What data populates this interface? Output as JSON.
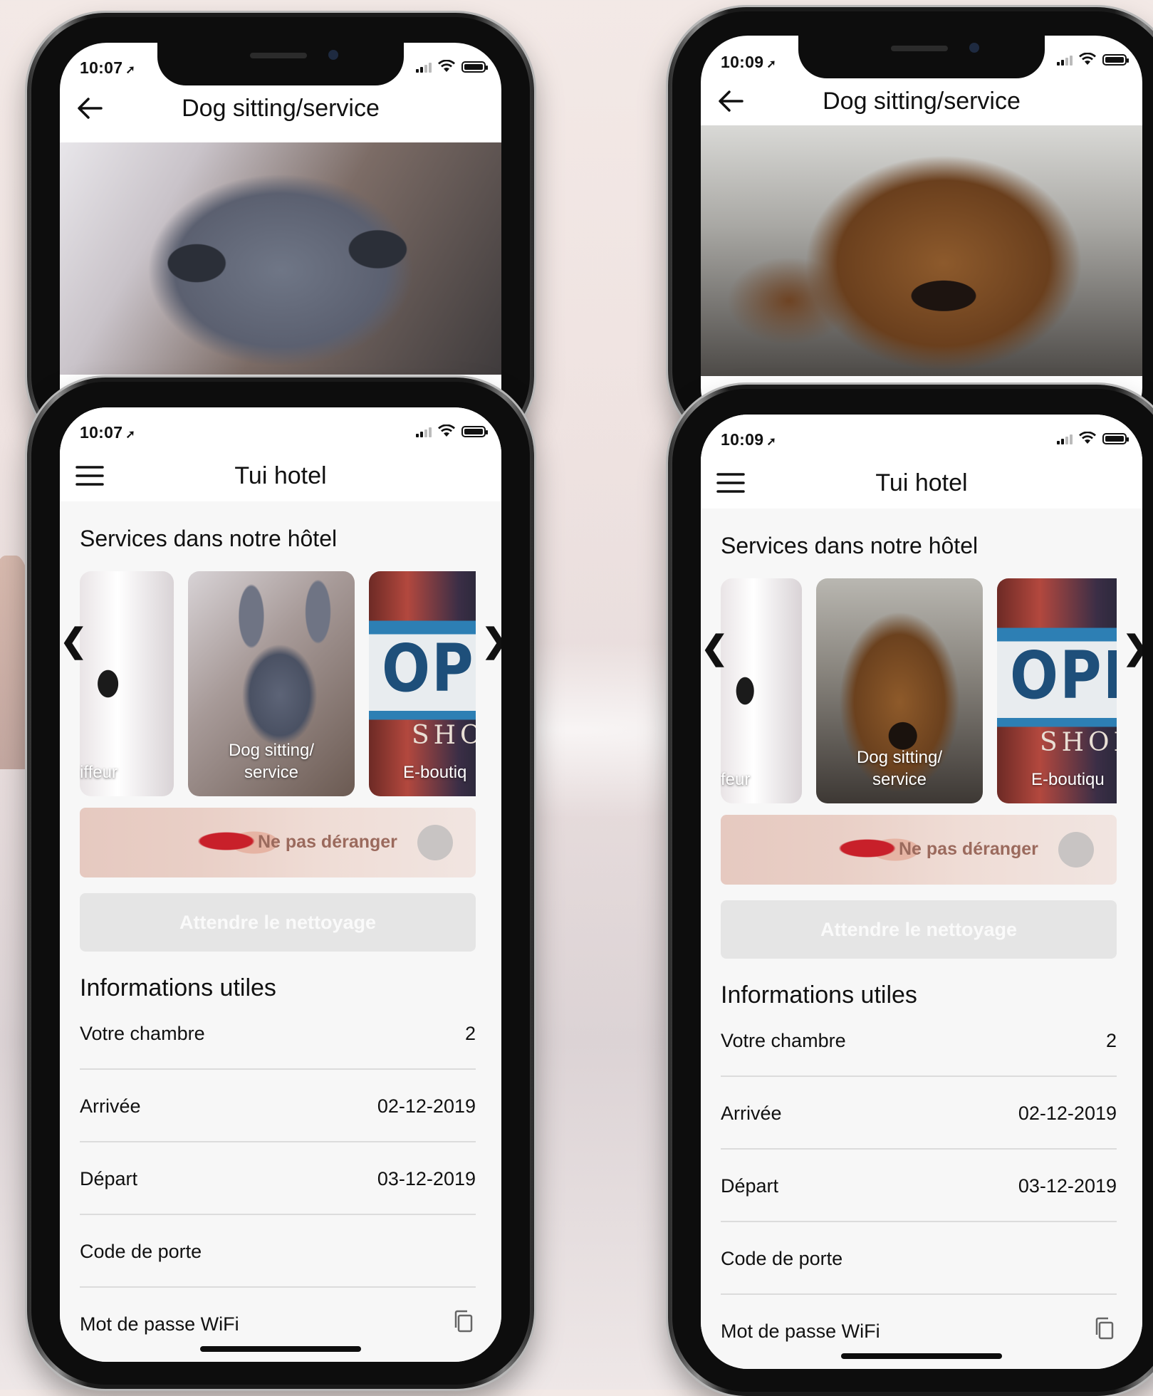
{
  "phones": {
    "left_back": {
      "time": "10:07",
      "title": "Dog sitting/service"
    },
    "left_front": {
      "time": "10:07",
      "title": "Tui hotel"
    },
    "right_back": {
      "time": "10:09",
      "title": "Dog sitting/service"
    },
    "right_front": {
      "time": "10:09",
      "title": "Tui hotel"
    }
  },
  "home": {
    "services_title": "Services dans notre hôtel",
    "cards": {
      "coiffeur": "iffeur",
      "coiffeur_right": "feur",
      "dog_line1": "Dog sitting/",
      "dog_line2": "service",
      "shop_left": "E-boutiq",
      "shop_right": "E-boutiqu"
    },
    "shop_sign_open": "OPE",
    "shop_sign_word": "SHOP",
    "carousel_prev": "❮",
    "carousel_next": "❯",
    "do_not_disturb": "Ne pas déranger",
    "wait_cleaning": "Attendre le nettoyage",
    "info_title": "Informations utiles",
    "info": {
      "room_label": "Votre chambre",
      "room_value": "2",
      "arrival_label": "Arrivée",
      "arrival_value": "02-12-2019",
      "departure_label": "Départ",
      "departure_value": "03-12-2019",
      "door_code_label": "Code de porte",
      "door_code_value": "",
      "wifi_label": "Mot de passe WiFi"
    }
  },
  "icons": {
    "back": "arrow-left-icon",
    "menu": "hamburger-menu-icon",
    "copy": "copy-icon",
    "location": "location-arrow-icon",
    "signal": "cellular-signal-icon",
    "wifi": "wifi-icon",
    "battery": "battery-icon"
  },
  "colors": {
    "page_bg": "#f7f7f7",
    "disabled_button": "#e5e5e5",
    "dnd_text": "#9b6a5d"
  }
}
